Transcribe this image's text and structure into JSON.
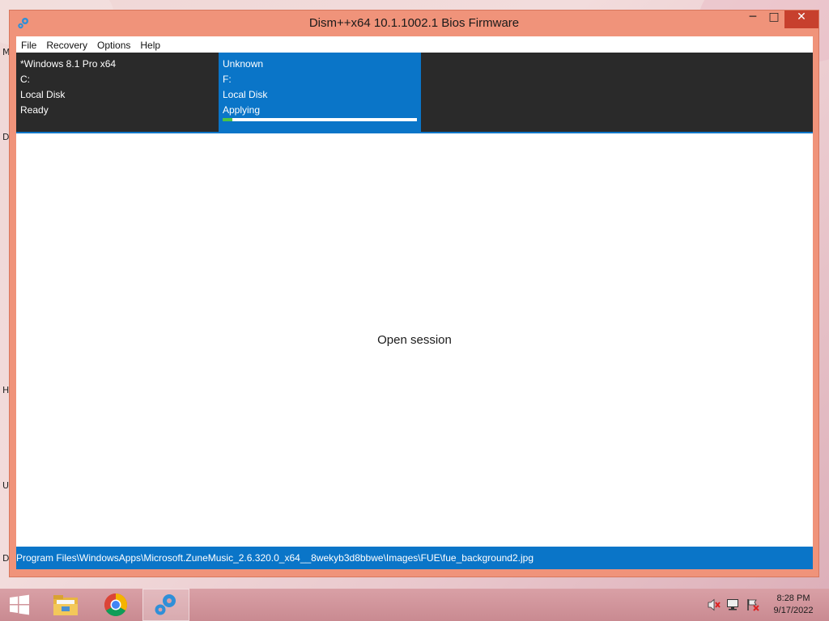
{
  "window": {
    "title": "Dism++x64 10.1.1002.1 Bios Firmware",
    "controls": {
      "minimize": "─",
      "maximize": "□",
      "close": "✕"
    }
  },
  "menu": [
    "File",
    "Recovery",
    "Options",
    "Help"
  ],
  "sessions": [
    {
      "name": "*Windows 8.1 Pro x64",
      "drive": "C:",
      "disk": "Local Disk",
      "status": "Ready",
      "selected": false
    },
    {
      "name": "Unknown",
      "drive": "F:",
      "disk": "Local Disk",
      "status": "Applying",
      "selected": true,
      "progress": 0.05
    }
  ],
  "content": {
    "message": "Open session"
  },
  "statusbar": {
    "text": "Program Files\\WindowsApps\\Microsoft.ZuneMusic_2.6.320.0_x64__8wekyb3d8bbwe\\Images\\FUE\\fue_background2.jpg"
  },
  "desktop_letters": [
    "M",
    "D",
    "H",
    "U",
    "D"
  ],
  "taskbar": {
    "apps": [
      {
        "name": "file-explorer-icon"
      },
      {
        "name": "chrome-icon"
      },
      {
        "name": "dism-icon",
        "active": true
      }
    ],
    "tray": [
      "volume-muted-icon",
      "network-icon",
      "action-center-flag-icon"
    ],
    "clock": {
      "time": "8:28 PM",
      "date": "9/17/2022"
    }
  },
  "colors": {
    "window_frame": "#f0937a",
    "accent_blue": "#0a75c8",
    "session_dark": "#2a2a2a",
    "close_red": "#c7402d",
    "progress_green": "#4cc446"
  }
}
